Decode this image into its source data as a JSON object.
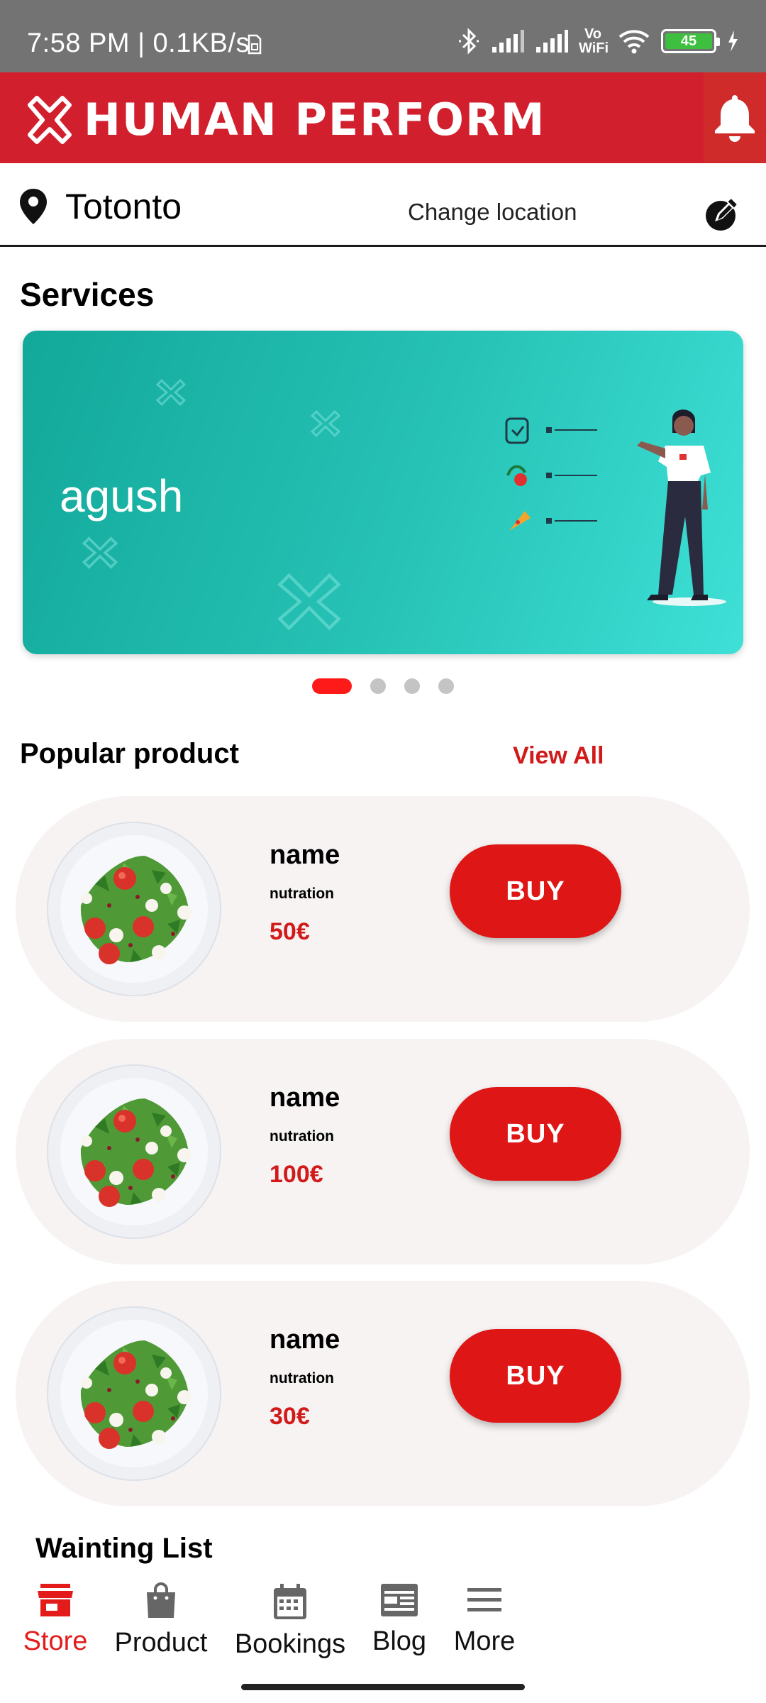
{
  "status_bar": {
    "time": "7:58 PM | 0.1KB/s",
    "network_label": "Vo WiFi",
    "battery": "45"
  },
  "header": {
    "brand": "HUMAN PERFORM"
  },
  "location": {
    "city": "Totonto",
    "change_label": "Change location"
  },
  "services": {
    "title": "Services",
    "banner_text": "agush",
    "carousel_pages": 4,
    "carousel_active": 0
  },
  "popular": {
    "title": "Popular product",
    "view_all": "View All",
    "products": [
      {
        "name": "name",
        "subtitle": "nutration",
        "price": "50€",
        "button": "BUY"
      },
      {
        "name": "name",
        "subtitle": "nutration",
        "price": "100€",
        "button": "BUY"
      },
      {
        "name": "name",
        "subtitle": "nutration",
        "price": "30€",
        "button": "BUY"
      }
    ]
  },
  "waiting_list": {
    "title": "Wainting List"
  },
  "nav": {
    "items": [
      {
        "label": "Store",
        "icon": "store-icon",
        "active": true
      },
      {
        "label": "Product",
        "icon": "shopping-bag-icon",
        "active": false
      },
      {
        "label": "Bookings",
        "icon": "calendar-icon",
        "active": false
      },
      {
        "label": "Blog",
        "icon": "newspaper-icon",
        "active": false
      },
      {
        "label": "More",
        "icon": "menu-icon",
        "active": false
      }
    ]
  },
  "colors": {
    "brand_red": "#d21f2e",
    "accent_red": "#de1616",
    "banner_teal": "#27c3b6",
    "status_gray": "#737373"
  }
}
